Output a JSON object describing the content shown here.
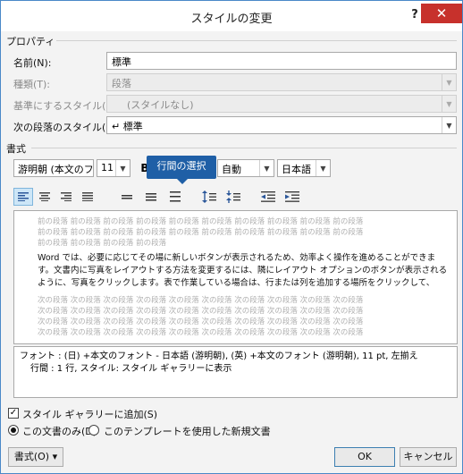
{
  "window": {
    "title": "スタイルの変更",
    "help_label": "?",
    "close_label": "✕"
  },
  "properties": {
    "section_label": "プロパティ",
    "name_label": "名前(N):",
    "name_value": "標準",
    "type_label": "種類(T):",
    "type_value": "段落",
    "based_on_label": "基準にするスタイル(B):",
    "based_on_value": "(スタイルなし)",
    "next_style_label": "次の段落のスタイル(S):",
    "next_style_value": "↵ 標準"
  },
  "formatting": {
    "section_label": "書式",
    "font_value": "游明朝 (本文のフ",
    "size_value": "11",
    "bold_label": "B",
    "color_value": "自動",
    "language_value": "日本語",
    "tooltip": "行間の選択",
    "toolbar_icons": [
      "align-left-icon",
      "align-center-icon",
      "align-right-icon",
      "justify-icon",
      "single-spacing-icon",
      "one-half-spacing-icon",
      "double-spacing-icon",
      "increase-paragraph-spacing-icon",
      "decrease-paragraph-spacing-icon",
      "decrease-indent-icon",
      "increase-indent-icon"
    ]
  },
  "preview": {
    "prev_lines": [
      "前の段落 前の段落 前の段落 前の段落 前の段落 前の段落 前の段落 前の段落 前の段落 前の段落",
      "前の段落 前の段落 前の段落 前の段落 前の段落 前の段落 前の段落 前の段落 前の段落 前の段落",
      "前の段落 前の段落 前の段落 前の段落"
    ],
    "sample_text": "Word では、必要に応じてその場に新しいボタンが表示されるため、効率よく操作を進めることができます。文書内に写真をレイアウトする方法を変更するには、隣にレイアウト オプションのボタンが表示されるように、写真をクリックします。表で作業している場合は、行または列を追加する場所をクリックして、",
    "next_lines": [
      "次の段落 次の段落 次の段落 次の段落 次の段落 次の段落 次の段落 次の段落 次の段落 次の段落",
      "次の段落 次の段落 次の段落 次の段落 次の段落 次の段落 次の段落 次の段落 次の段落 次の段落",
      "次の段落 次の段落 次の段落 次の段落 次の段落 次の段落 次の段落 次の段落 次の段落 次の段落",
      "次の段落 次の段落 次の段落 次の段落 次の段落 次の段落 次の段落 次の段落 次の段落 次の段落"
    ]
  },
  "description": {
    "line1": "フォント : (日) +本文のフォント - 日本語 (游明朝), (英) +本文のフォント (游明朝), 11 pt, 左揃え",
    "line2": "行間 : 1 行, スタイル: スタイル ギャラリーに表示"
  },
  "options": {
    "add_gallery_label": "スタイル ギャラリーに追加(S)",
    "add_gallery_checked": true,
    "this_doc_label": "この文書のみ(D)",
    "new_docs_label": "このテンプレートを使用した新規文書",
    "selected": "this_doc"
  },
  "buttons": {
    "format_label": "書式(O) ▾",
    "ok_label": "OK",
    "cancel_label": "キャンセル"
  },
  "colors": {
    "accent": "#1f5fa6",
    "close_red": "#c7312c"
  }
}
